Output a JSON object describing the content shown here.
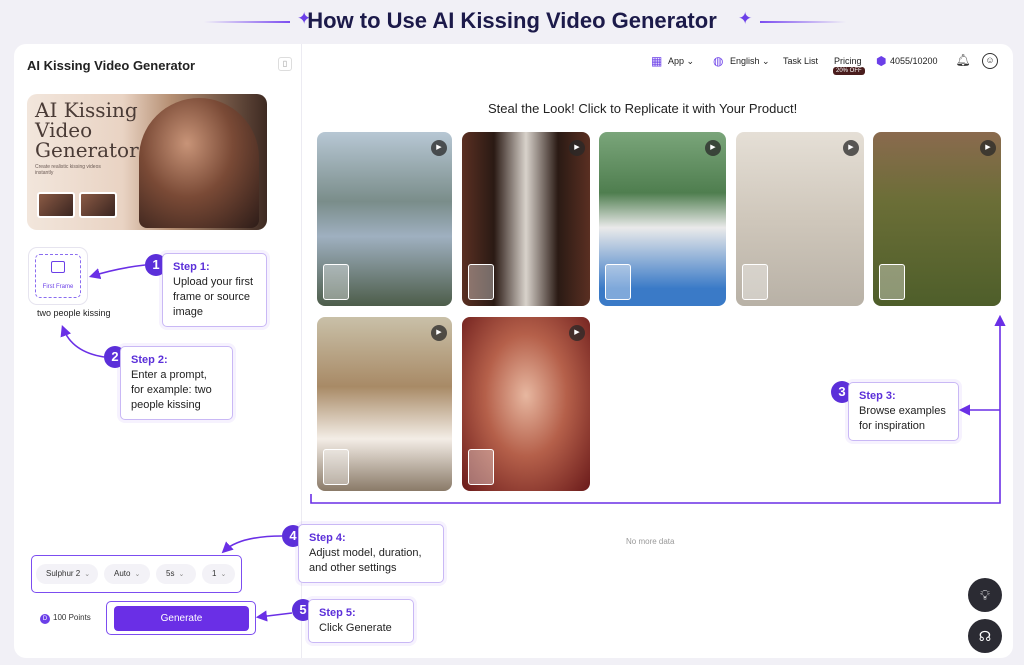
{
  "banner": {
    "title": "How to Use AI Kissing Video Generator"
  },
  "sidebar": {
    "app_name": "AI Kissing Video Generator",
    "hero": {
      "title": "AI Kissing Video Generator",
      "subtitle": "Create realistic kissing videos instantly"
    },
    "upload": {
      "label": "First Frame"
    },
    "prompt": "two people kissing",
    "settings": {
      "model": "Sulphur 2",
      "mode": "Auto",
      "duration": "5s",
      "count": "1"
    },
    "points": "100 Points",
    "generate_label": "Generate"
  },
  "topbar": {
    "app_menu": "App",
    "language": "English",
    "task_list": "Task List",
    "pricing": "Pricing",
    "pricing_badge": "20% OFF",
    "credits": "4055/10200"
  },
  "main": {
    "heading": "Steal the Look! Click to Replicate it with Your Product!",
    "empty_text": "No more data",
    "examples_count": 7
  },
  "steps": {
    "s1": {
      "num": "1",
      "title": "Step 1:",
      "text": "Upload your first frame or source image"
    },
    "s2": {
      "num": "2",
      "title": "Step 2:",
      "text": "Enter a prompt, for example: two people kissing"
    },
    "s3": {
      "num": "3",
      "title": "Step 3:",
      "text": "Browse examples for inspiration"
    },
    "s4": {
      "num": "4",
      "title": "Step 4:",
      "text": "Adjust model, duration, and other settings"
    },
    "s5": {
      "num": "5",
      "title": "Step 5:",
      "text": "Click Generate"
    }
  },
  "colors": {
    "accent": "#6a2fe6",
    "banner_text": "#1c1a4a",
    "float_bg": "#2b2b33"
  },
  "icons": [
    "sparkle-icon",
    "bookmark-icon",
    "image-upload-icon",
    "coin-icon",
    "app-grid-icon",
    "globe-icon",
    "chevron-down-icon",
    "bell-icon",
    "avatar-icon",
    "play-icon",
    "lightbulb-icon",
    "support-icon"
  ]
}
